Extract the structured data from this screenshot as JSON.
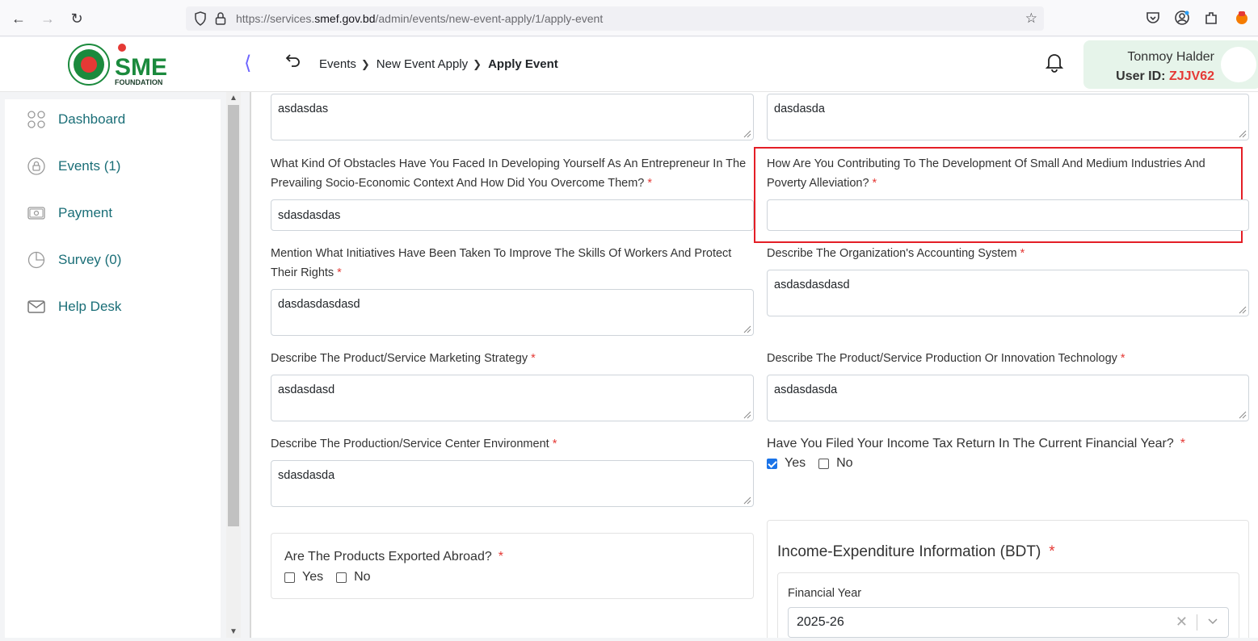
{
  "browser": {
    "url_prefix": "https://services.",
    "url_domain": "smef.gov.bd",
    "url_path": "/admin/events/new-event-apply/1/apply-event"
  },
  "header": {
    "logo_text": "SME",
    "logo_sub": "FOUNDATION",
    "breadcrumb": [
      "Events",
      "New Event Apply",
      "Apply Event"
    ],
    "user_name": "Tonmoy Halder",
    "user_id_label": "User ID:",
    "user_id": "ZJJV62"
  },
  "sidebar": {
    "items": [
      {
        "label": "Dashboard",
        "icon": "grid-icon"
      },
      {
        "label": "Events (1)",
        "icon": "lock-circle-icon"
      },
      {
        "label": "Payment",
        "icon": "payment-icon"
      },
      {
        "label": "Survey (0)",
        "icon": "pie-chart-icon"
      },
      {
        "label": "Help Desk",
        "icon": "mail-icon"
      }
    ]
  },
  "form": {
    "top_left_value": "asdasdas",
    "top_right_value": "dasdasda",
    "obstacles_label": "What Kind Of Obstacles Have You Faced In Developing Yourself As An Entrepreneur In The Prevailing Socio-Economic Context And How Did You Overcome Them?",
    "obstacles_value": "sdasdasdas",
    "contributing_label": "How Are You Contributing To The Development Of Small And Medium Industries And Poverty Alleviation?",
    "contributing_value": "",
    "initiatives_label": "Mention What Initiatives Have Been Taken To Improve The Skills Of Workers And Protect Their Rights",
    "initiatives_value": "dasdasdasdasd",
    "accounting_label": "Describe The Organization's Accounting System",
    "accounting_value": "asdasdasdasd",
    "marketing_label": "Describe The Product/Service Marketing Strategy",
    "marketing_value": "asdasdasd",
    "production_tech_label": "Describe The Product/Service Production Or Innovation Technology",
    "production_tech_value": "asdasdasda",
    "environment_label": "Describe The Production/Service Center Environment",
    "environment_value": "sdasdasda",
    "income_tax_label": "Have You Filed Your Income Tax Return In The Current Financial Year?",
    "income_tax_yes": "Yes",
    "income_tax_no": "No",
    "export_label": "Are The Products Exported Abroad?",
    "export_yes": "Yes",
    "export_no": "No",
    "income_section_title": "Income-Expenditure Information (BDT)",
    "financial_year_label": "Financial Year",
    "financial_year_value": "2025-26",
    "required_mark": "*"
  },
  "colors": {
    "accent_teal": "#1a6e77",
    "required_red": "#e53935",
    "highlight_red": "#e41e26",
    "checkbox_blue": "#1a73e8"
  }
}
